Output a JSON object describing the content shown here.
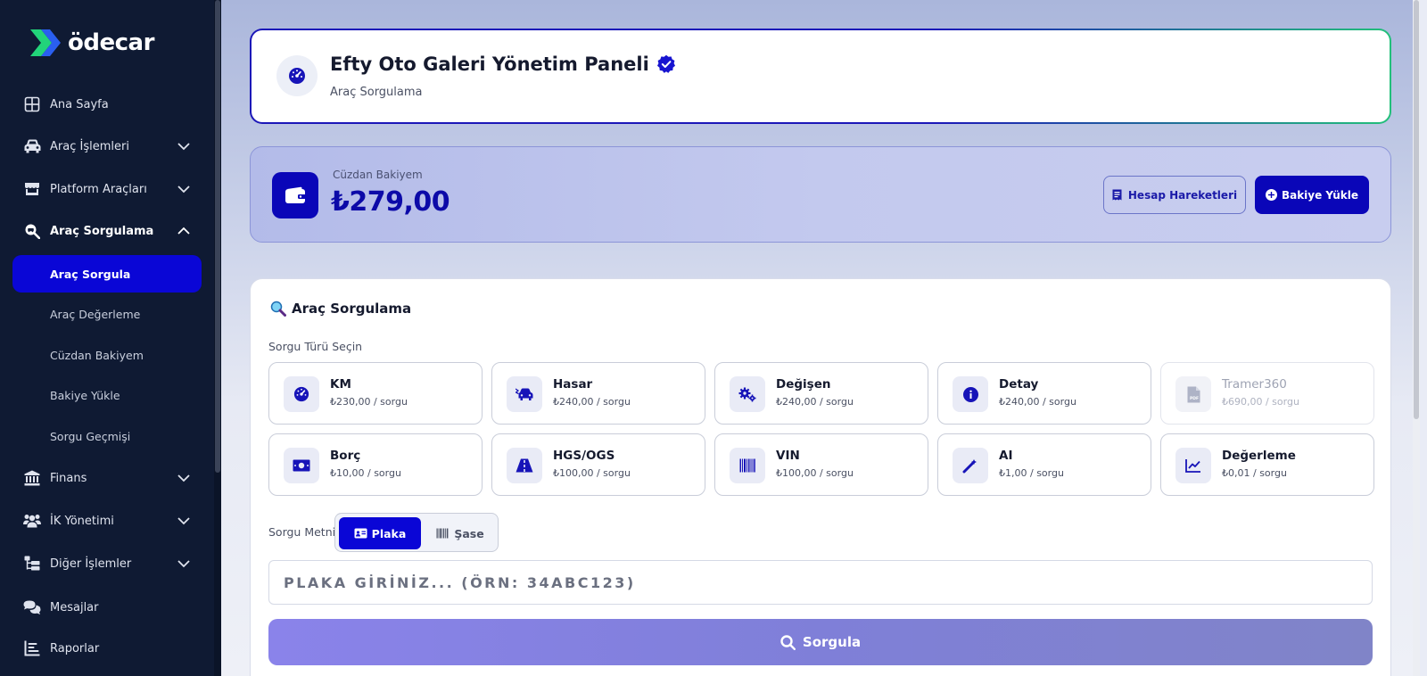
{
  "colors": {
    "primary": "#0a06d6",
    "sidebar_bg": "#0f1a33",
    "accent_green": "#22c07a"
  },
  "sidebar": {
    "logo_text": "ödecar",
    "items": [
      {
        "label": "Ana Sayfa",
        "icon": "grid-icon"
      },
      {
        "label": "Araç İşlemleri",
        "icon": "car-icon"
      },
      {
        "label": "Platform Araçları",
        "icon": "store-icon"
      },
      {
        "label": "Araç Sorgulama",
        "icon": "search-car-icon"
      },
      {
        "label": "Finans",
        "icon": "bank-icon"
      },
      {
        "label": "İK Yönetimi",
        "icon": "users-icon"
      },
      {
        "label": "Diğer İşlemler",
        "icon": "sitemap-icon"
      },
      {
        "label": "Mesajlar",
        "icon": "chat-icon"
      },
      {
        "label": "Raporlar",
        "icon": "chart-icon"
      }
    ],
    "sub_items": [
      "Araç Sorgula",
      "Araç Değerleme",
      "Cüzdan Bakiyem",
      "Bakiye Yükle",
      "Sorgu Geçmişi"
    ]
  },
  "header": {
    "title": "Efty Oto Galeri Yönetim Paneli",
    "subtitle": "Araç Sorgulama"
  },
  "wallet": {
    "label": "Cüzdan Bakiyem",
    "amount": "₺279,00",
    "history_button": "Hesap Hareketleri",
    "topup_button": "Bakiye Yükle"
  },
  "query": {
    "title": "Araç Sorgulama",
    "type_label": "Sorgu Türü Seçin",
    "types": [
      {
        "name": "KM",
        "price": "₺230,00 / sorgu"
      },
      {
        "name": "Hasar",
        "price": "₺240,00 / sorgu"
      },
      {
        "name": "Değişen",
        "price": "₺240,00 / sorgu"
      },
      {
        "name": "Detay",
        "price": "₺240,00 / sorgu"
      },
      {
        "name": "Tramer360",
        "price": "₺690,00 / sorgu"
      },
      {
        "name": "Borç",
        "price": "₺10,00 / sorgu"
      },
      {
        "name": "HGS/OGS",
        "price": "₺100,00 / sorgu"
      },
      {
        "name": "VIN",
        "price": "₺100,00 / sorgu"
      },
      {
        "name": "AI",
        "price": "₺1,00 / sorgu"
      },
      {
        "name": "Değerleme",
        "price": "₺0,01 / sorgu"
      }
    ],
    "text_label": "Sorgu Metni",
    "mode_plate": "Plaka",
    "mode_chassis": "Şase",
    "input_placeholder": "PLAKA GİRİNİZ... (ÖRN: 34ABC123)",
    "input_value": "",
    "search_button": "Sorgula"
  }
}
